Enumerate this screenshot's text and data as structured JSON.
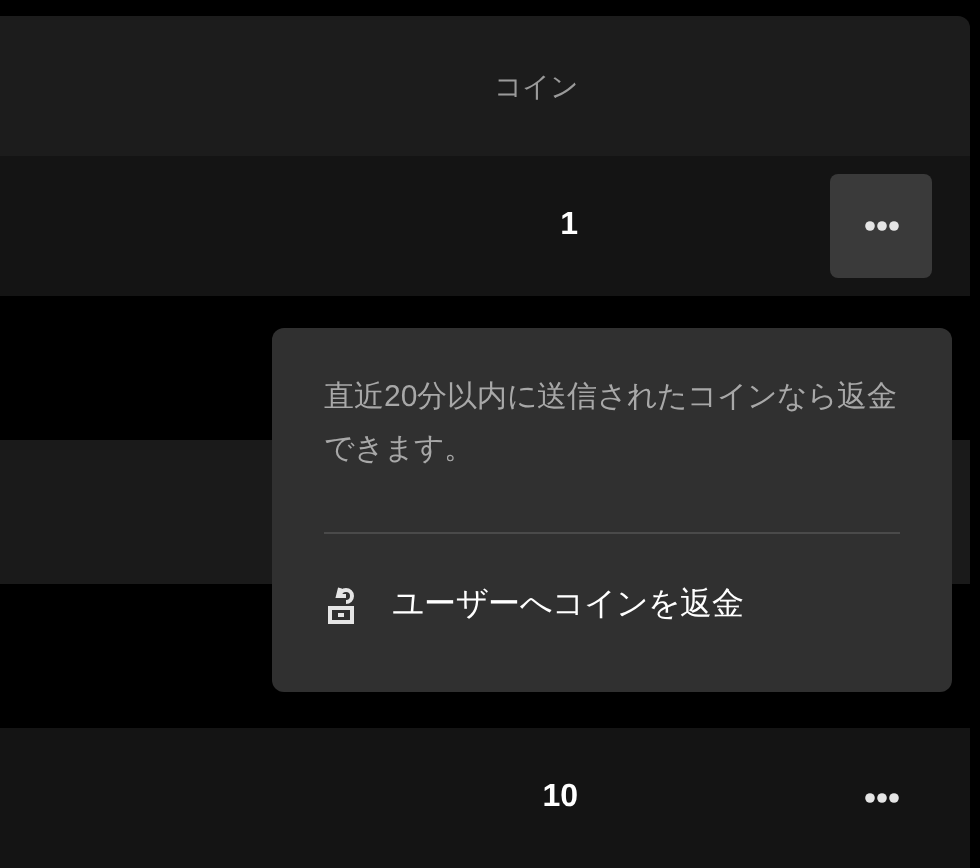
{
  "table": {
    "columns": [
      {
        "label": "コイン"
      }
    ],
    "rows": [
      {
        "coins": "1",
        "menu_open": true
      },
      {
        "coins": "10",
        "menu_open": false
      }
    ]
  },
  "popup": {
    "note": "直近20分以内に送信されたコインなら返金できます。",
    "action": "ユーザーへコインを返金"
  }
}
